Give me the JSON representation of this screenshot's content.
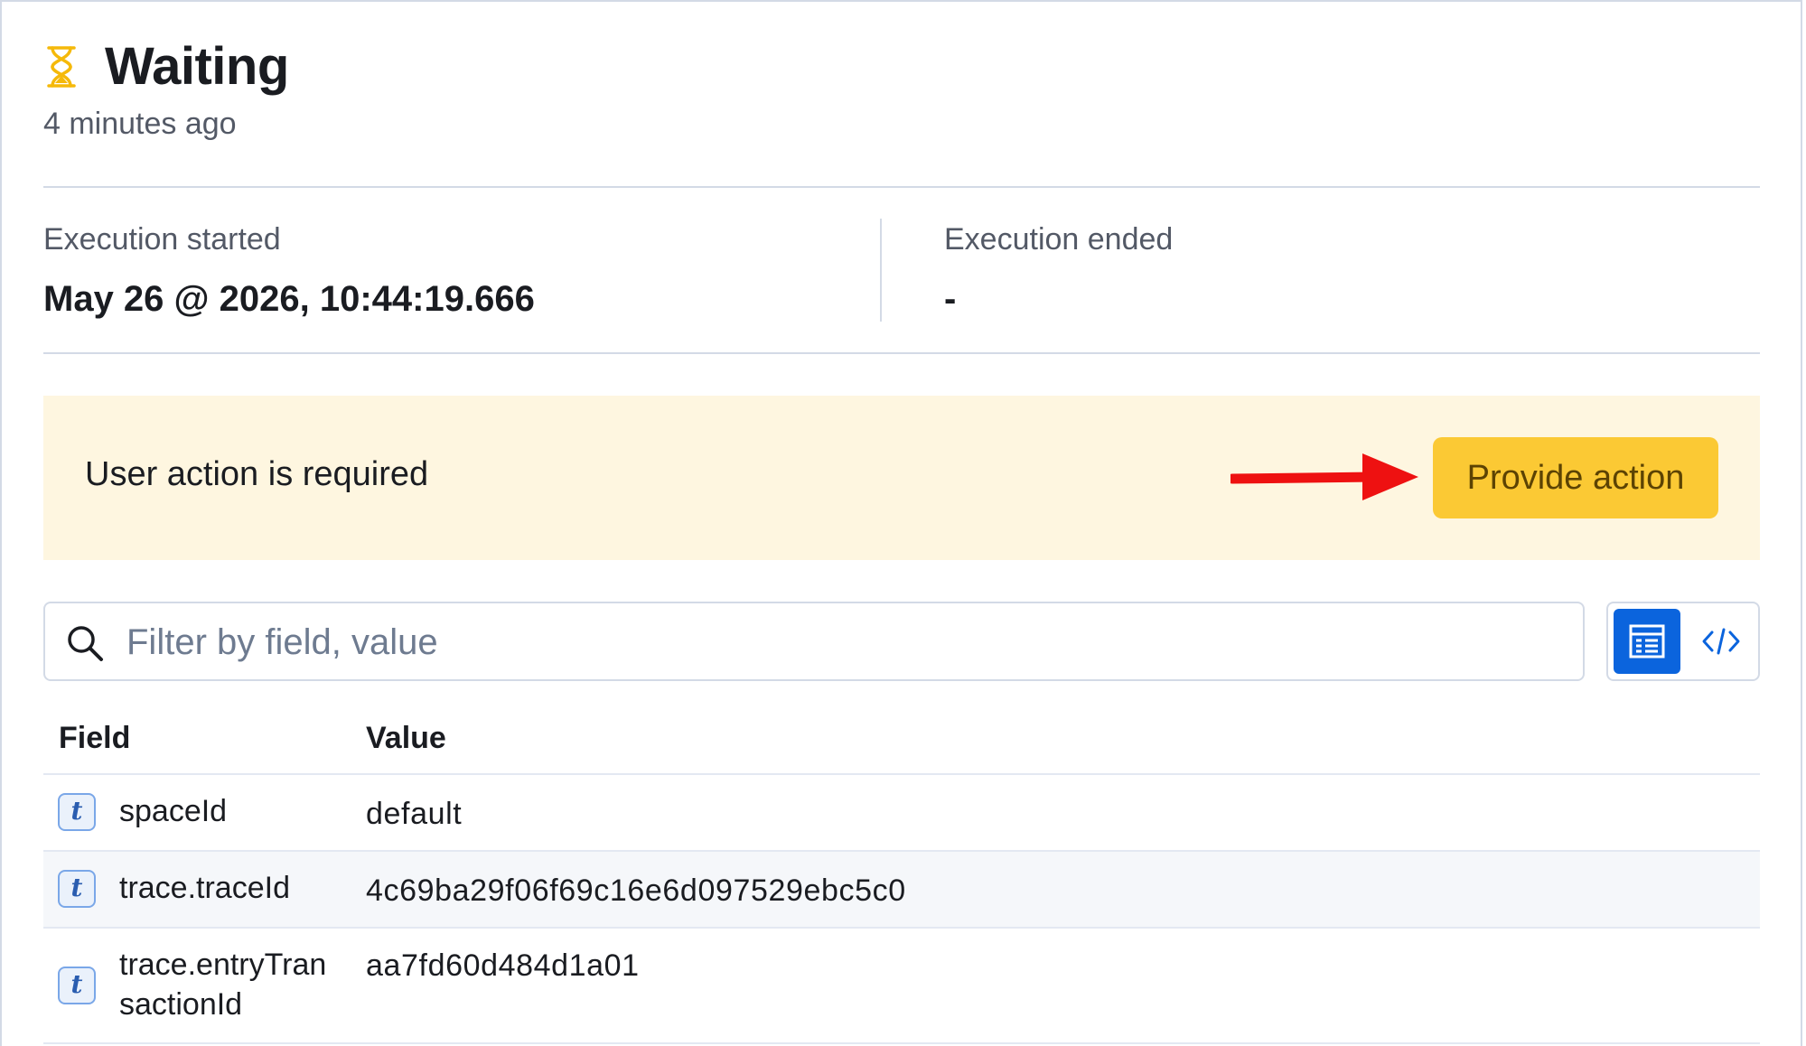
{
  "header": {
    "title": "Waiting",
    "subtitle": "4 minutes ago",
    "icon": "hourglass-icon",
    "icon_color": "#f5b90a"
  },
  "execution": {
    "started_label": "Execution started",
    "started_value": "May 26 @ 2026, 10:44:19.666",
    "ended_label": "Execution ended",
    "ended_value": "-"
  },
  "callout": {
    "message": "User action is required",
    "button_label": "Provide action",
    "background": "#fef6e0",
    "button_color": "#fbc934",
    "annotation_arrow_color": "#ee1111"
  },
  "search": {
    "placeholder": "Filter by field, value",
    "value": ""
  },
  "view_toggle": {
    "options": [
      "table-view",
      "json-view"
    ],
    "selected": "table-view",
    "accent": "#0b64dd"
  },
  "table": {
    "columns": [
      "Field",
      "Value"
    ],
    "rows": [
      {
        "type": "t",
        "field": "spaceId",
        "value": "default"
      },
      {
        "type": "t",
        "field": "trace.traceId",
        "value": "4c69ba29f06f69c16e6d097529ebc5c0"
      },
      {
        "type": "t",
        "field": "trace.entryTransactionId",
        "value": "aa7fd60d484d1a01"
      }
    ]
  }
}
